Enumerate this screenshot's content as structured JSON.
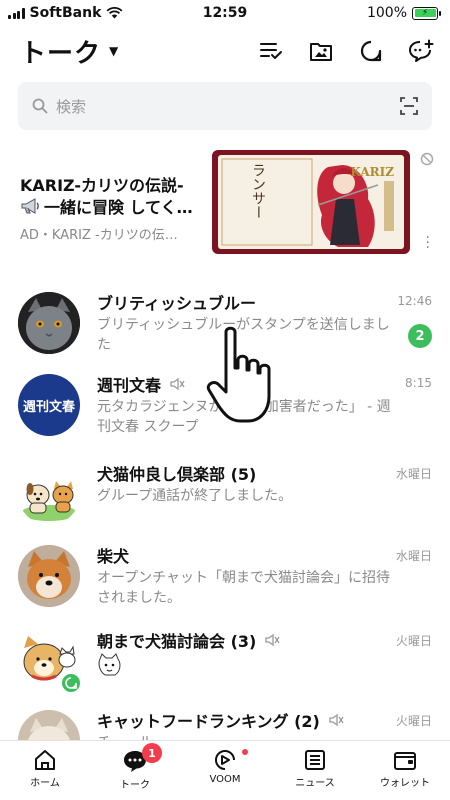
{
  "status_bar": {
    "carrier": "SoftBank",
    "time": "12:59",
    "battery": "100%"
  },
  "header": {
    "title": "トーク"
  },
  "search": {
    "placeholder": "検索"
  },
  "ad": {
    "title": "KARIZ-カリツの伝説-",
    "subtitle": "一緒に冒険 してく…",
    "meta": "AD・KARIZ -カリツの伝…",
    "banner_brand": "KARIZ",
    "banner_character": "ランサー"
  },
  "chats": [
    {
      "name": "ブリティッシュブルー",
      "message": "ブリティッシュブルーがスタンプを送信しました",
      "time": "12:46",
      "unread": "2",
      "muted": false
    },
    {
      "name": "週刊文春",
      "message": "元タカラジェンヌが「私も加害者だった」 - 週刊文春 スクープ",
      "time": "8:15",
      "muted": true,
      "avatar_text": "週刊文春"
    },
    {
      "name": "犬猫仲良し倶楽部 (5)",
      "message": "グループ通話が終了しました。",
      "time": "水曜日",
      "muted": false
    },
    {
      "name": "柴犬",
      "message": "オープンチャット「朝まで犬猫討論会」に招待されました。",
      "time": "水曜日",
      "muted": false
    },
    {
      "name": "朝まで犬猫討論会 (3)",
      "message": "",
      "time": "火曜日",
      "muted": true
    },
    {
      "name": "キャットフードランキング (2)",
      "message": "チュール",
      "time": "火曜日",
      "muted": true
    }
  ],
  "tabs": [
    {
      "label": "ホーム"
    },
    {
      "label": "トーク",
      "badge": "1"
    },
    {
      "label": "VOOM"
    },
    {
      "label": "ニュース"
    },
    {
      "label": "ウォレット"
    }
  ],
  "colors": {
    "unread_badge": "#3cbe5c",
    "notification_red": "#f23d4c",
    "search_bg": "#f2f3f5"
  }
}
